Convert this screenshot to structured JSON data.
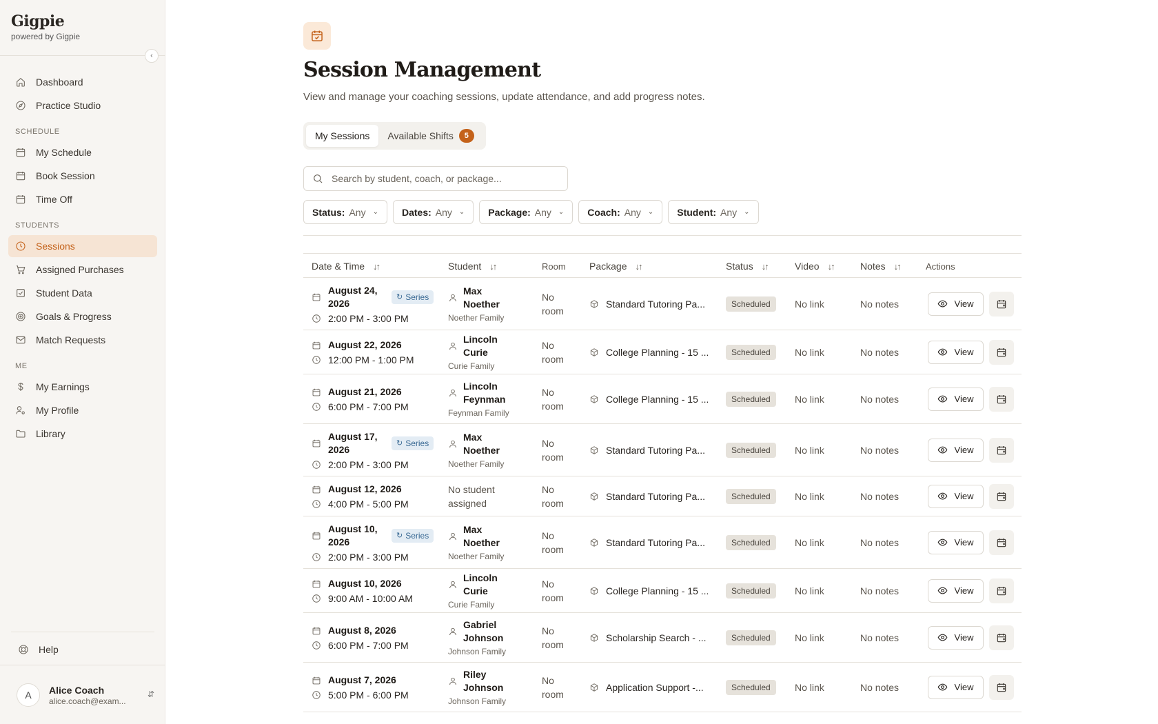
{
  "app": {
    "name": "Gigpie",
    "tagline": "powered by Gigpie"
  },
  "sidebar": {
    "top_items": [
      {
        "label": "Dashboard",
        "icon": "home-icon"
      },
      {
        "label": "Practice Studio",
        "icon": "compass-icon"
      }
    ],
    "sections": [
      {
        "title": "SCHEDULE",
        "items": [
          {
            "label": "My Schedule",
            "icon": "calendar-icon"
          },
          {
            "label": "Book Session",
            "icon": "calendar-icon"
          },
          {
            "label": "Time Off",
            "icon": "calendar-icon"
          }
        ]
      },
      {
        "title": "STUDENTS",
        "items": [
          {
            "label": "Sessions",
            "icon": "clock-icon",
            "active": true
          },
          {
            "label": "Assigned Purchases",
            "icon": "cart-icon"
          },
          {
            "label": "Student Data",
            "icon": "checkbox-icon"
          },
          {
            "label": "Goals & Progress",
            "icon": "target-icon"
          },
          {
            "label": "Match Requests",
            "icon": "mail-icon"
          }
        ]
      },
      {
        "title": "ME",
        "items": [
          {
            "label": "My Earnings",
            "icon": "dollar-icon"
          },
          {
            "label": "My Profile",
            "icon": "user-cog-icon"
          },
          {
            "label": "Library",
            "icon": "folder-icon"
          }
        ]
      }
    ],
    "help_label": "Help",
    "user": {
      "initial": "A",
      "name": "Alice Coach",
      "email": "alice.coach@exam..."
    }
  },
  "page": {
    "title": "Session Management",
    "description": "View and manage your coaching sessions, update attendance, and add progress notes.",
    "tabs": [
      {
        "label": "My Sessions",
        "active": true
      },
      {
        "label": "Available Shifts",
        "badge": "5"
      }
    ],
    "search_placeholder": "Search by student, coach, or package...",
    "filters": [
      {
        "label": "Status:",
        "value": "Any"
      },
      {
        "label": "Dates:",
        "value": "Any"
      },
      {
        "label": "Package:",
        "value": "Any"
      },
      {
        "label": "Coach:",
        "value": "Any"
      },
      {
        "label": "Student:",
        "value": "Any"
      }
    ]
  },
  "table": {
    "columns": {
      "datetime": "Date & Time",
      "student": "Student",
      "room": "Room",
      "package": "Package",
      "status": "Status",
      "video": "Video",
      "notes": "Notes",
      "actions": "Actions"
    },
    "view_label": "View",
    "series_label": "Series",
    "rows": [
      {
        "date": "August 24, 2026",
        "time": "2:00 PM - 3:00 PM",
        "series": true,
        "student": "Max Noether",
        "family": "Noether Family",
        "room": "No room",
        "package": "Standard Tutoring Pa...",
        "status": "Scheduled",
        "video": "No link",
        "notes": "No notes"
      },
      {
        "date": "August 22, 2026",
        "time": "12:00 PM - 1:00 PM",
        "series": false,
        "student": "Lincoln Curie",
        "family": "Curie Family",
        "room": "No room",
        "package": "College Planning - 15 ...",
        "status": "Scheduled",
        "video": "No link",
        "notes": "No notes"
      },
      {
        "date": "August 21, 2026",
        "time": "6:00 PM - 7:00 PM",
        "series": false,
        "student": "Lincoln Feynman",
        "family": "Feynman Family",
        "room": "No room",
        "package": "College Planning - 15 ...",
        "status": "Scheduled",
        "video": "No link",
        "notes": "No notes"
      },
      {
        "date": "August 17, 2026",
        "time": "2:00 PM - 3:00 PM",
        "series": true,
        "student": "Max Noether",
        "family": "Noether Family",
        "room": "No room",
        "package": "Standard Tutoring Pa...",
        "status": "Scheduled",
        "video": "No link",
        "notes": "No notes"
      },
      {
        "date": "August 12, 2026",
        "time": "4:00 PM - 5:00 PM",
        "series": false,
        "student": "",
        "no_student": "No student assigned",
        "family": "",
        "room": "No room",
        "package": "Standard Tutoring Pa...",
        "status": "Scheduled",
        "video": "No link",
        "notes": "No notes"
      },
      {
        "date": "August 10, 2026",
        "time": "2:00 PM - 3:00 PM",
        "series": true,
        "student": "Max Noether",
        "family": "Noether Family",
        "room": "No room",
        "package": "Standard Tutoring Pa...",
        "status": "Scheduled",
        "video": "No link",
        "notes": "No notes"
      },
      {
        "date": "August 10, 2026",
        "time": "9:00 AM - 10:00 AM",
        "series": false,
        "student": "Lincoln Curie",
        "family": "Curie Family",
        "room": "No room",
        "package": "College Planning - 15 ...",
        "status": "Scheduled",
        "video": "No link",
        "notes": "No notes"
      },
      {
        "date": "August 8, 2026",
        "time": "6:00 PM - 7:00 PM",
        "series": false,
        "student": "Gabriel Johnson",
        "family": "Johnson Family",
        "room": "No room",
        "package": "Scholarship Search - ...",
        "status": "Scheduled",
        "video": "No link",
        "notes": "No notes"
      },
      {
        "date": "August 7, 2026",
        "time": "5:00 PM - 6:00 PM",
        "series": false,
        "student": "Riley Johnson",
        "family": "Johnson Family",
        "room": "No room",
        "package": "Application Support -...",
        "status": "Scheduled",
        "video": "No link",
        "notes": "No notes"
      }
    ]
  },
  "colors": {
    "accent": "#c4621a",
    "active_bg": "#f6e4d4",
    "series_bg": "#e3ecf4",
    "status_bg": "#e6e2db"
  }
}
